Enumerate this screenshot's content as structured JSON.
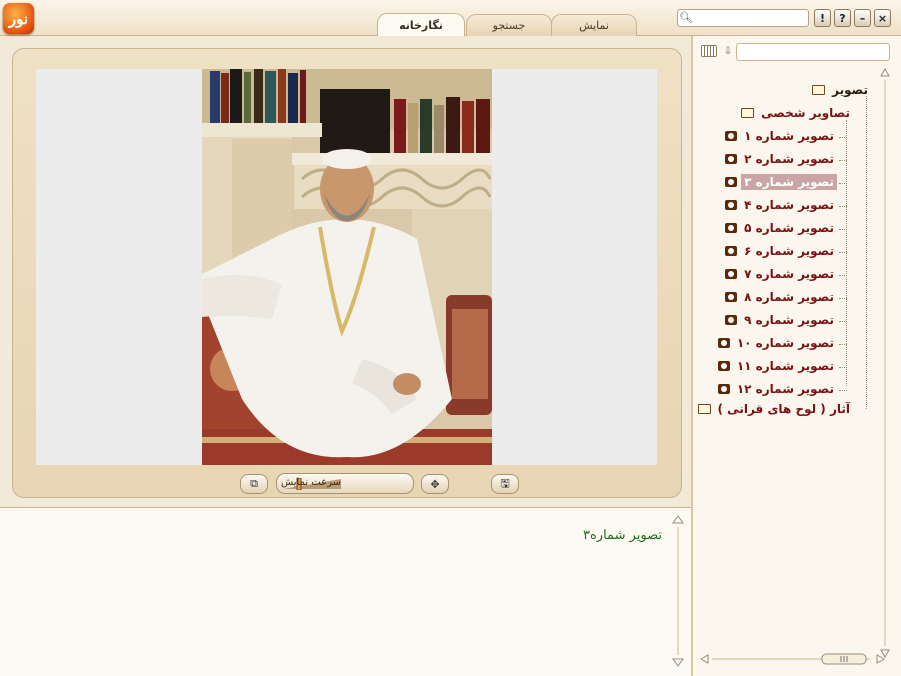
{
  "app": {
    "logo_text": "نور"
  },
  "tabs": [
    {
      "label": "نمایش"
    },
    {
      "label": "جستجو"
    },
    {
      "label": "نگارخانه"
    }
  ],
  "window_buttons": {
    "info": "!",
    "help": "?",
    "minimize": "–",
    "close": "×"
  },
  "top_search": {
    "placeholder": ""
  },
  "tree_search": {
    "placeholder": ""
  },
  "viewer": {
    "speed_label": "سرعت نمایش"
  },
  "caption": {
    "text": "تصویر شماره۳"
  },
  "tree": {
    "root": "تصویر",
    "group_personal": "تصاویر شخصی",
    "items": [
      "تصویر شماره ۱",
      "تصویر شماره ۲",
      "تصویر شماره ۳",
      "تصویر شماره ۴",
      "تصویر شماره ۵",
      "تصویر شماره ۶",
      "تصویر شماره ۷",
      "تصویر شماره ۸",
      "تصویر شماره ۹",
      "تصویر شماره ۱۰",
      "تصویر شماره ۱۱",
      "تصویر شماره ۱۲"
    ],
    "selected_index": 2,
    "group_works": "آثار ( لوح های قرانی )"
  },
  "colors": {
    "accent": "#7a1212",
    "caption": "#1f6b1f",
    "selection": "#c9a5a5"
  }
}
